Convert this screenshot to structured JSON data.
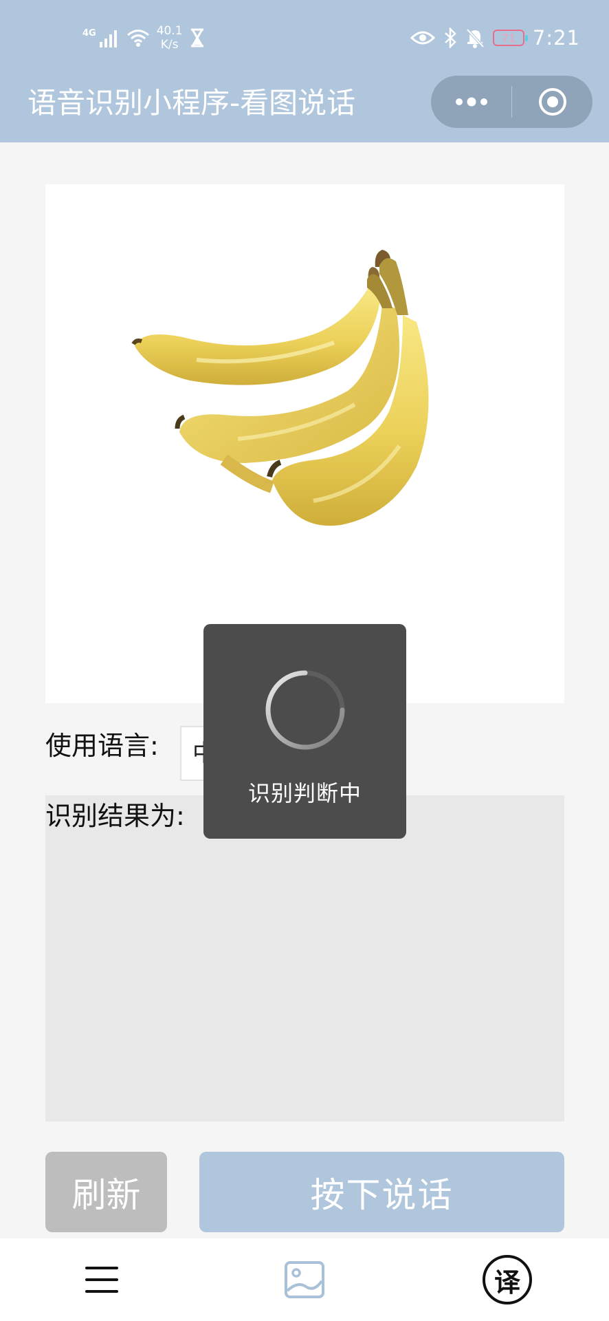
{
  "status_bar": {
    "network": "4G",
    "speed_value": "40.1",
    "speed_unit": "K/s",
    "battery": "71",
    "time": "7:21"
  },
  "header": {
    "title": "语音识别小程序-看图说话"
  },
  "main": {
    "language_label": "使用语言:",
    "language_value": "中",
    "result_label": "识别结果为:",
    "result_text": ""
  },
  "buttons": {
    "refresh_label": "刷新",
    "speak_label": "按下说话"
  },
  "toast": {
    "text": "识别判断中"
  },
  "tabbar": {
    "translate_glyph": "译"
  },
  "colors": {
    "header": "#afc6dc",
    "toast": "#4c4c4c",
    "refresh": "#bdbdbd",
    "speak": "#afc6dc"
  },
  "icons": [
    "signal-icon",
    "wifi-icon",
    "hourglass-icon",
    "eye-icon",
    "bluetooth-icon",
    "bell-off-icon",
    "battery-icon",
    "more-icon",
    "close-target-icon",
    "menu-icon",
    "image-icon",
    "translate-icon",
    "loading-spinner-icon"
  ]
}
